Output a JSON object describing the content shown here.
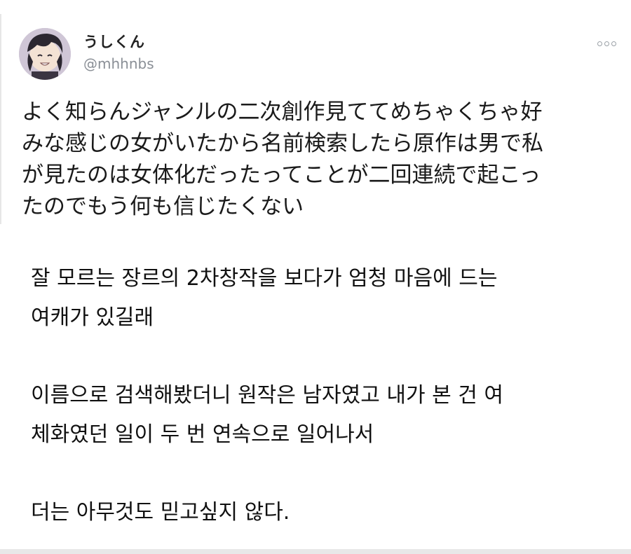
{
  "tweet": {
    "display_name": "うしくん",
    "handle": "@mhhnbs",
    "more_icon": "more-options-icon",
    "lines": [
      "よく知らんジャンルの二次創作見ててめちゃくちゃ好",
      "みな感じの女がいたから名前検索したら原作は男で私",
      "が見たのは女体化だったってことが二回連続で起こっ",
      "たのでもう何も信じたくない"
    ]
  },
  "translation": {
    "paragraphs": [
      [
        "잘 모르는 장르의 2차창작을 보다가 엄청 마음에 드는",
        "여캐가 있길래"
      ],
      [
        "이름으로 검색해봤더니 원작은 남자였고 내가 본 건 여",
        "체화였던 일이 두 번 연속으로 일어나서"
      ],
      [
        "더는 아무것도 믿고싶지 않다."
      ]
    ]
  }
}
